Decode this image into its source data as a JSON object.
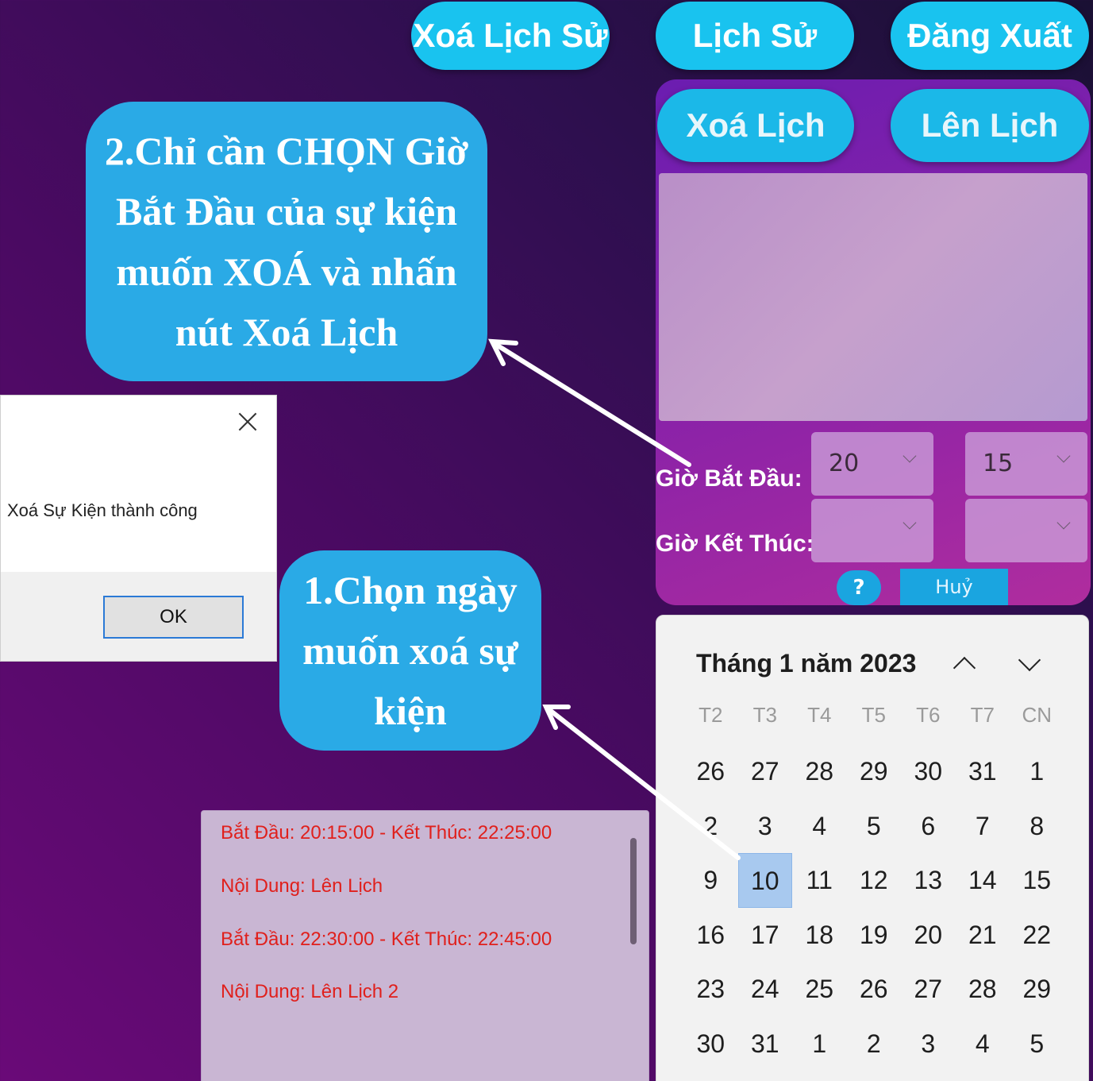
{
  "top_buttons": {
    "clear_history": "Xoá Lịch Sử",
    "history": "Lịch Sử",
    "logout": "Đăng Xuất"
  },
  "panel": {
    "delete_schedule": "Xoá Lịch",
    "add_schedule": "Lên Lịch",
    "start_label": "Giờ Bắt Đầu:",
    "end_label": "Giờ Kết Thúc:",
    "start_hour": "20",
    "start_minute": "15",
    "end_hour": "",
    "end_minute": "",
    "help": "?",
    "cancel": "Huỷ"
  },
  "calendar": {
    "title": "Tháng 1 năm 2023",
    "weekdays": [
      "T2",
      "T3",
      "T4",
      "T5",
      "T6",
      "T7",
      "CN"
    ],
    "days": [
      "26",
      "27",
      "28",
      "29",
      "30",
      "31",
      "1",
      "2",
      "3",
      "4",
      "5",
      "6",
      "7",
      "8",
      "9",
      "10",
      "11",
      "12",
      "13",
      "14",
      "15",
      "16",
      "17",
      "18",
      "19",
      "20",
      "21",
      "22",
      "23",
      "24",
      "25",
      "26",
      "27",
      "28",
      "29",
      "30",
      "31",
      "1",
      "2",
      "3",
      "4",
      "5"
    ],
    "selected": "10"
  },
  "dialog": {
    "message": "Xoá Sự Kiện thành công",
    "ok": "OK"
  },
  "events": [
    "Bắt Đầu: 20:15:00 - Kết Thúc: 22:25:00",
    "Nội Dung: Lên Lịch",
    "Bắt Đầu: 22:30:00 - Kết Thúc: 22:45:00",
    "Nội Dung: Lên Lịch 2"
  ],
  "annotations": {
    "step2_lines": [
      "2.Chỉ cần CHỌN Giờ",
      "Bắt Đầu của sự kiện",
      "muốn XOÁ và nhấn",
      "nút Xoá Lịch"
    ],
    "step1_lines": [
      "1.Chọn ngày",
      "muốn xoá sự",
      "kiện"
    ]
  },
  "colors": {
    "accent_cyan": "#19c3ef",
    "bubble_blue": "#2aaae6",
    "event_text_red": "#e0201c"
  }
}
